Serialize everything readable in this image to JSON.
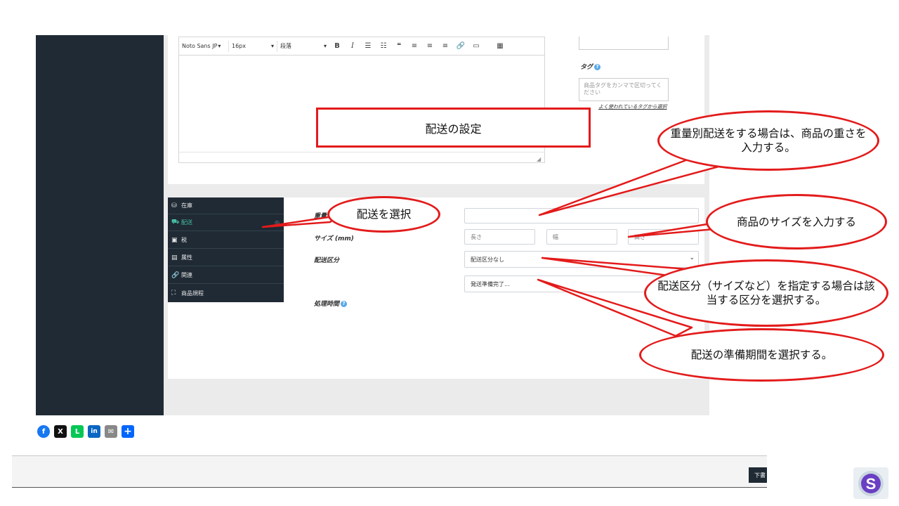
{
  "editor": {
    "font_family": "Noto Sans JP",
    "font_size": "16px",
    "block_format": "段落",
    "bold_label": "B",
    "italic_label": "I"
  },
  "tags": {
    "label": "タグ",
    "placeholder": "商品タグをカンマで区切ってください",
    "frequent_link": "よく使われているタグから選択"
  },
  "tabs": [
    {
      "label": "在庫",
      "icon": "database-icon"
    },
    {
      "label": "配送",
      "icon": "truck-icon",
      "active": true
    },
    {
      "label": "税",
      "icon": "money-icon"
    },
    {
      "label": "属性",
      "icon": "list-icon"
    },
    {
      "label": "関連",
      "icon": "link-icon"
    },
    {
      "label": "商品規程",
      "icon": "gift-icon"
    }
  ],
  "shipping": {
    "weight_label": "重量 (g)",
    "size_label": "サイズ (mm)",
    "length_placeholder": "長さ",
    "width_placeholder": "幅",
    "height_placeholder": "高さ",
    "class_label": "配送区分",
    "class_value": "配送区分なし",
    "processing_label": "処理時間",
    "processing_value": "発送準備完了..."
  },
  "footer": {
    "draft_button": "下書"
  },
  "share_icons": [
    {
      "name": "facebook-icon",
      "glyph": "f",
      "color": "#1877f2"
    },
    {
      "name": "x-icon",
      "glyph": "X",
      "color": "#111111"
    },
    {
      "name": "line-icon",
      "glyph": "L",
      "color": "#06c755"
    },
    {
      "name": "linkedin-icon",
      "glyph": "in",
      "color": "#0a66c2"
    },
    {
      "name": "email-icon",
      "glyph": "✉",
      "color": "#888888"
    },
    {
      "name": "addtoany-icon",
      "glyph": "+",
      "color": "#0166ff"
    }
  ],
  "annotations": {
    "title": "配送の設定",
    "select_shipping": "配送を選択",
    "weight_note": "重量別配送をする場合は、商品の重さを入力する。",
    "size_note": "商品のサイズを入力する",
    "class_note": "配送区分（サイズなど）を指定する場合は該当する区分を選択する。",
    "processing_note": "配送の準備期間を選択する。"
  },
  "colors": {
    "sidebar": "#1f2a34",
    "accent_active": "#47c0a8",
    "callout_red": "#e31b1b"
  }
}
